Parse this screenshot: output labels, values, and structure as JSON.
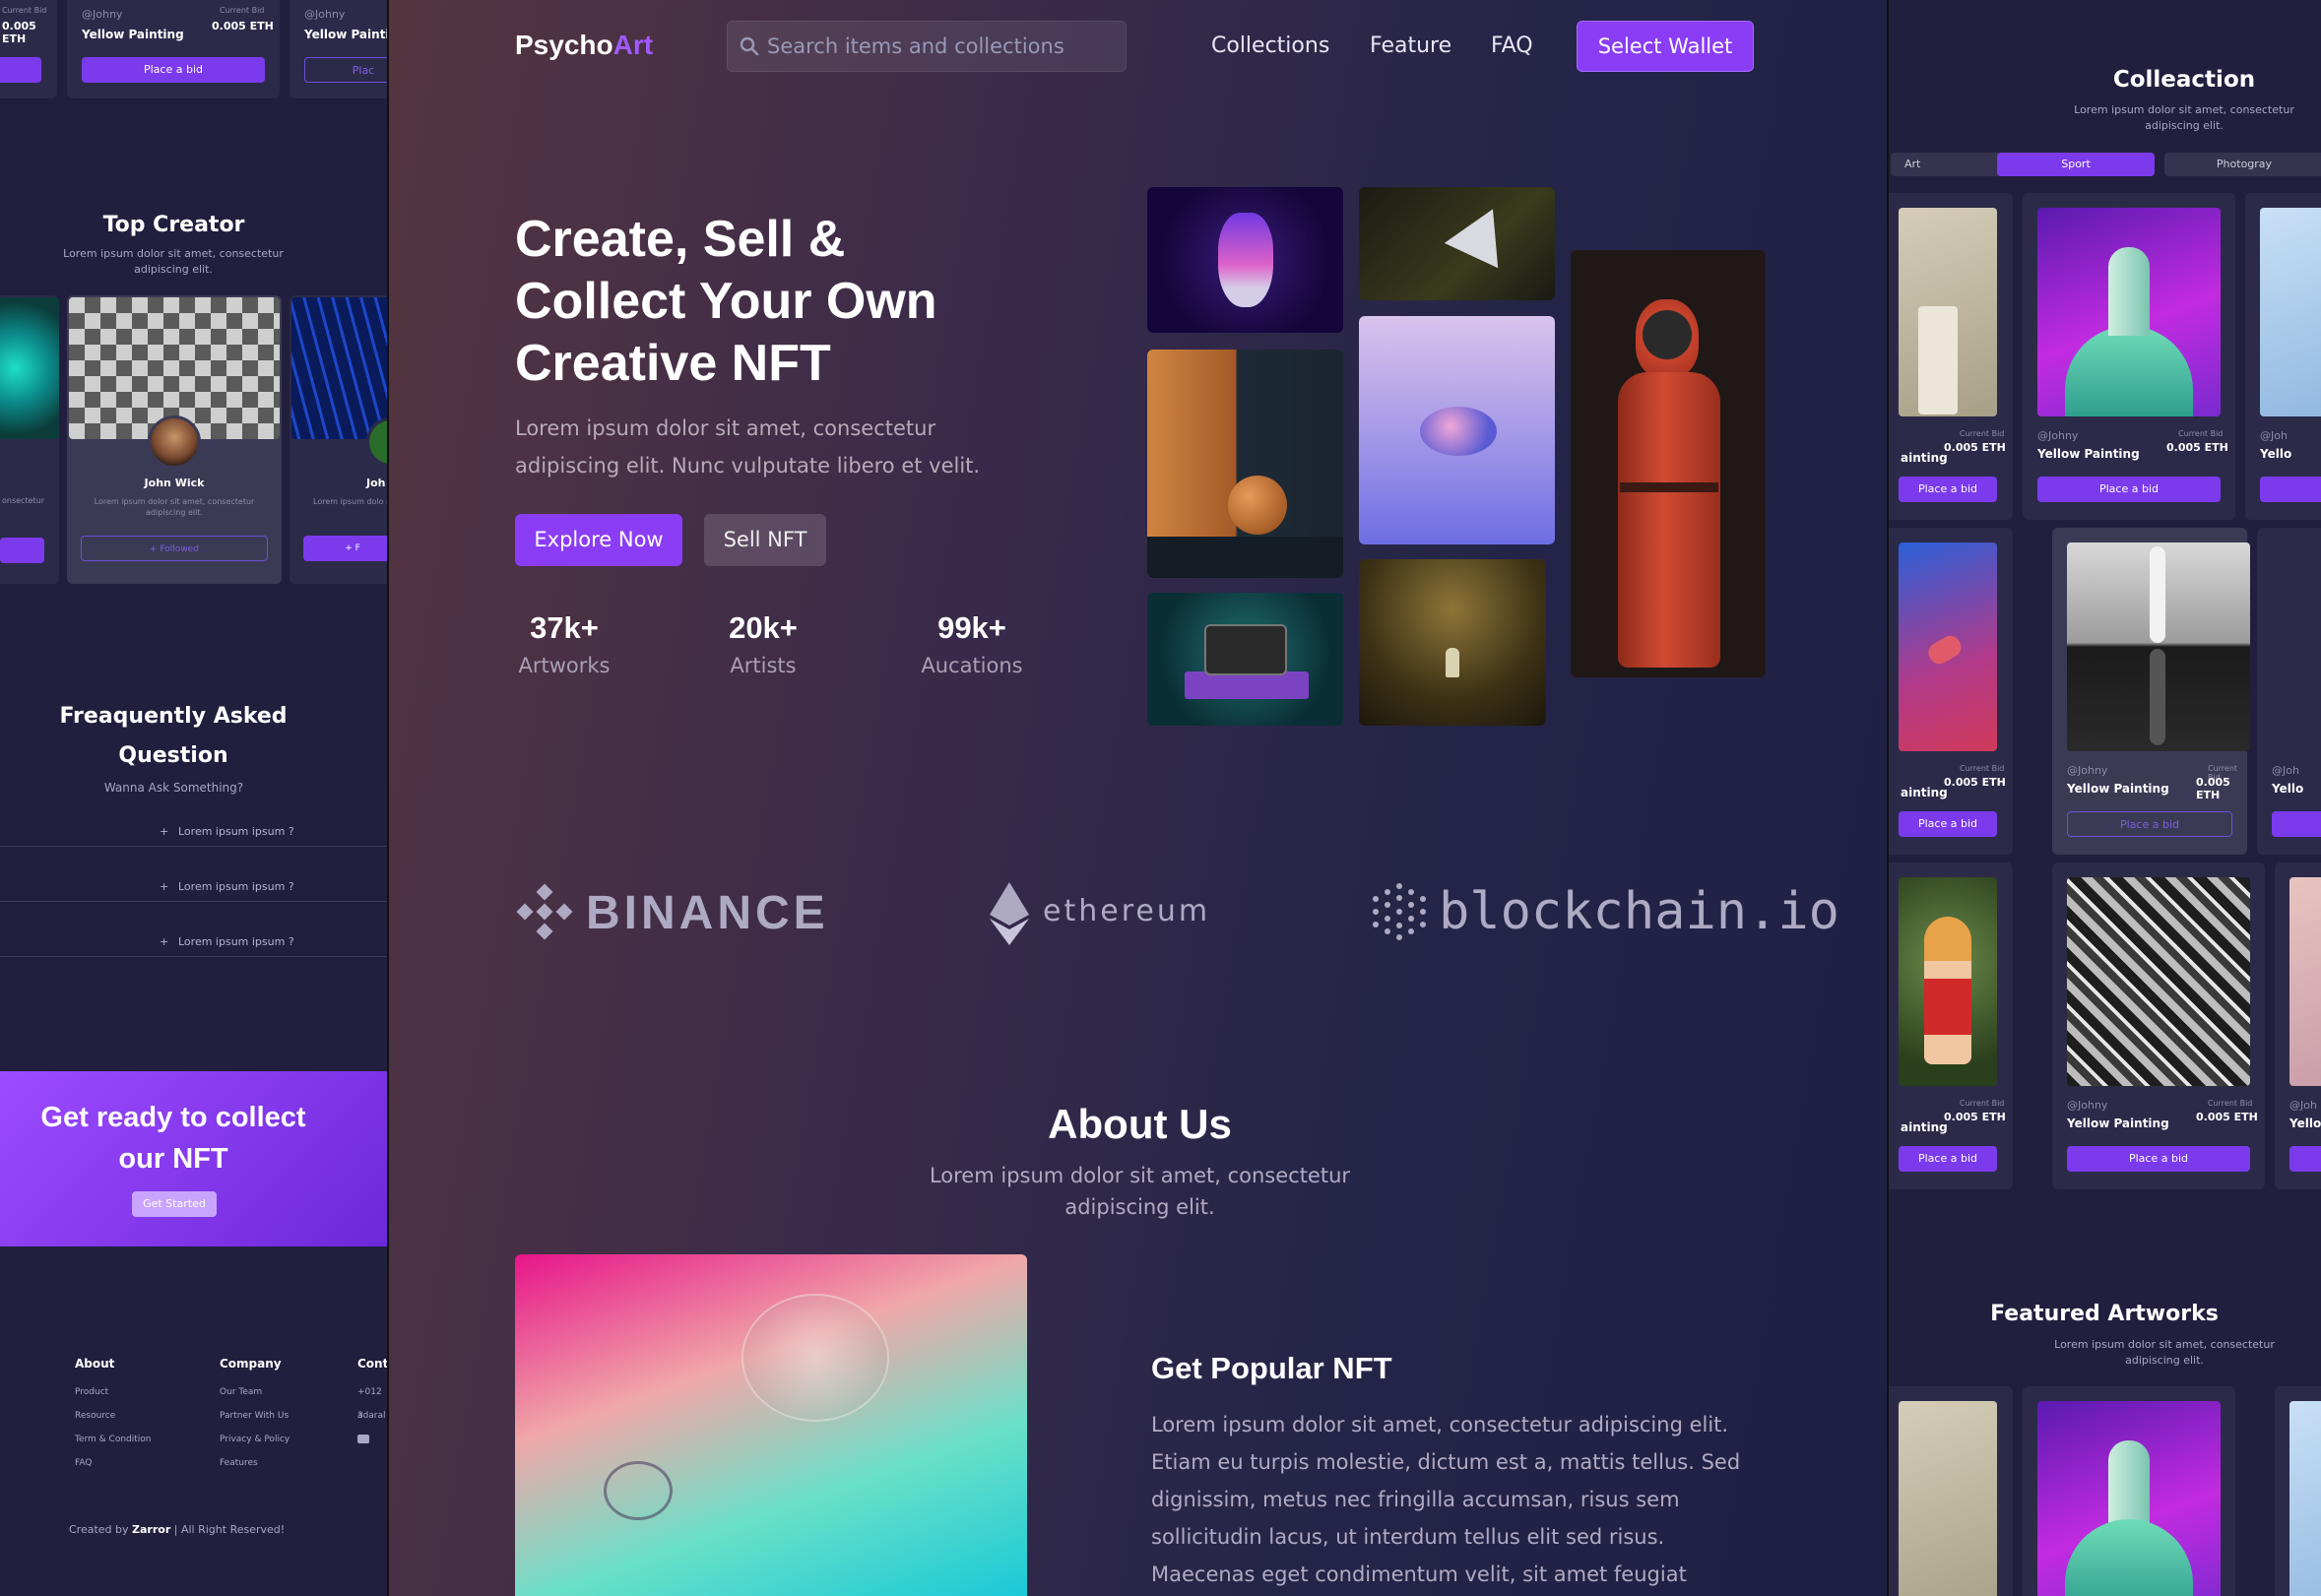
{
  "left": {
    "top_cards": [
      {
        "bid_label": "Current Bid",
        "price": "0.005 ETH",
        "button": ""
      },
      {
        "user": "@Johny",
        "bid_label": "Current Bid",
        "name": "Yellow Painting",
        "price": "0.005 ETH",
        "button": "Place a bid"
      },
      {
        "user": "@Johny",
        "name": "Yellow Painting",
        "button": "Plac"
      }
    ],
    "top_creator": {
      "title": "Top Creator",
      "subtitle": "Lorem ipsum dolor sit amet, consectetur adipiscing elit.",
      "cards": [
        {
          "desc": "onsectetur"
        },
        {
          "name": "John Wick",
          "desc": "Lorem ipsum dolor sit amet, consectetur adipiscing elit.",
          "button": "+ Followed"
        },
        {
          "name": "Joh",
          "desc": "Lorem ipsum dolo adipi",
          "button": "+ F"
        }
      ]
    },
    "faq": {
      "title": "Freaquently Asked Question",
      "subtitle": "Wanna Ask Something?",
      "items": [
        "Lorem ipsum ipsum ?",
        "Lorem ipsum ipsum ?",
        "Lorem ipsum ipsum ?"
      ]
    },
    "cta": {
      "title": "Get ready to collect our NFT",
      "button": "Get Started"
    },
    "footer": {
      "about": {
        "title": "About",
        "links": [
          "Product",
          "Resource",
          "Term & Condition",
          "FAQ"
        ]
      },
      "company": {
        "title": "Company",
        "links": [
          "Our Team",
          "Partner With Us",
          "Privacy & Policy",
          "Features"
        ]
      },
      "contact": {
        "title": "Cont",
        "links": [
          "+012 3",
          "adaral"
        ]
      },
      "credit_prefix": "Created by",
      "credit_brand": "Zarror",
      "credit_suffix": "| All Right Reserved!"
    }
  },
  "main": {
    "brand": {
      "part1": "Psycho",
      "part2": "Art"
    },
    "search": {
      "placeholder": "Search items and collections"
    },
    "nav": [
      "Collections",
      "Feature",
      "FAQ"
    ],
    "wallet_button": "Select Wallet",
    "hero": {
      "title": "Create, Sell & Collect Your Own Creative NFT",
      "description": "Lorem ipsum dolor sit amet, consectetur adipiscing elit. Nunc vulputate libero et velit.",
      "explore": "Explore Now",
      "sell": "Sell NFT"
    },
    "stats": [
      {
        "value": "37k+",
        "label": "Artworks"
      },
      {
        "value": "20k+",
        "label": "Artists"
      },
      {
        "value": "99k+",
        "label": "Aucations"
      }
    ],
    "partners": [
      "BINANCE",
      "ethereum",
      "blockchain.io"
    ],
    "about": {
      "title": "About Us",
      "subtitle": "Lorem ipsum dolor sit amet, consectetur adipiscing elit.",
      "popular_title": "Get Popular NFT",
      "popular_text": "Lorem ipsum dolor sit amet, consectetur adipiscing elit. Etiam eu turpis molestie, dictum est a, mattis tellus. Sed dignissim, metus nec fringilla accumsan, risus sem sollicitudin lacus, ut interdum tellus elit sed risus. Maecenas eget condimentum velit, sit amet feugiat"
    }
  },
  "right": {
    "collection": {
      "title": "Colleaction",
      "subtitle": "Lorem ipsum dolor sit amet, consectetur adipiscing elit.",
      "filters": [
        "Art",
        "Sport",
        "Photogray"
      ]
    },
    "cards": [
      {
        "user": "",
        "bid_label": "Current Bid",
        "name": "ainting",
        "price": "0.005 ETH",
        "button": "Place a bid"
      },
      {
        "user": "@Johny",
        "bid_label": "Current Bid",
        "name": "Yellow Painting",
        "price": "0.005 ETH",
        "button": "Place a bid"
      },
      {
        "user": "@Joh",
        "name": "Yello"
      },
      {
        "user": "",
        "bid_label": "Current Bid",
        "name": "ainting",
        "price": "0.005 ETH",
        "button": "Place a bid"
      },
      {
        "user": "@Johny",
        "bid_label": "Current Bid",
        "name": "Yellow Painting",
        "price": "0.005 ETH",
        "button": "Place a bid"
      },
      {
        "user": "@Joh",
        "name": "Yello"
      },
      {
        "user": "",
        "bid_label": "Current Bid",
        "name": "ainting",
        "price": "0.005 ETH",
        "button": "Place a bid"
      },
      {
        "user": "@Johny",
        "bid_label": "Current Bid",
        "name": "Yellow Painting",
        "price": "0.005 ETH",
        "button": "Place a bid"
      },
      {
        "user": "@Joh",
        "name": "Yello"
      }
    ],
    "featured": {
      "title": "Featured Artworks",
      "subtitle": "Lorem ipsum dolor sit amet, consectetur adipiscing elit."
    }
  }
}
